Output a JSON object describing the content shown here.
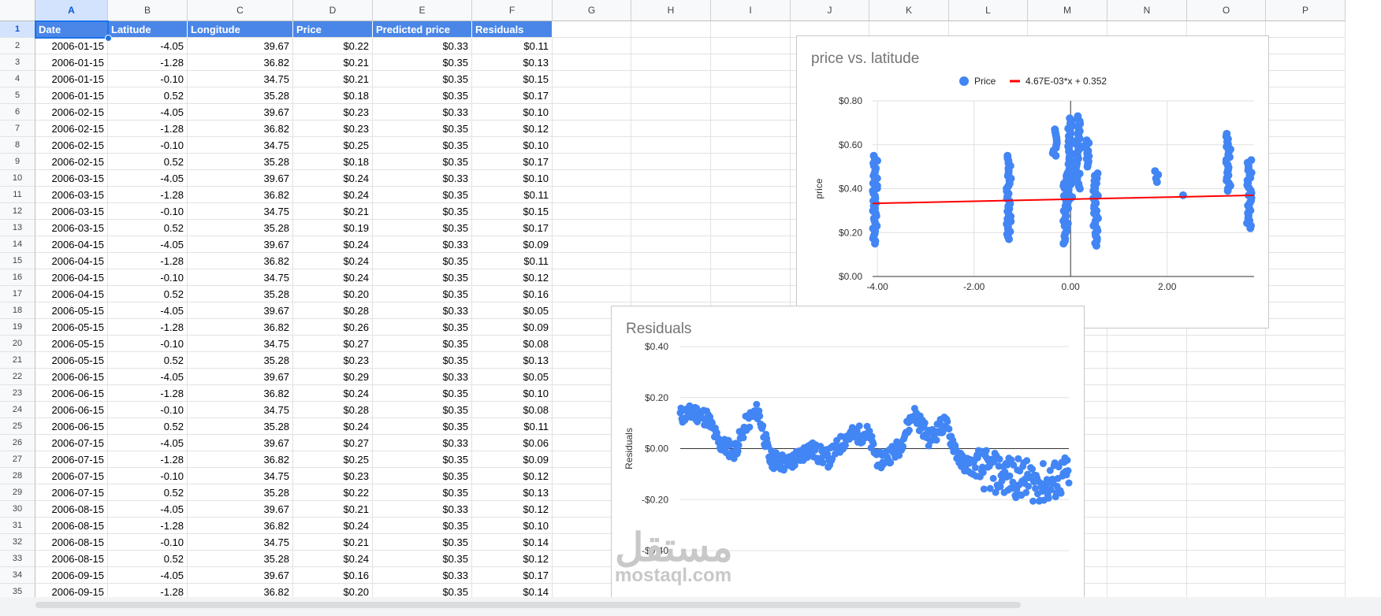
{
  "columns": [
    "A",
    "B",
    "C",
    "D",
    "E",
    "F",
    "G",
    "H",
    "I",
    "J",
    "K",
    "L",
    "M",
    "N",
    "O",
    "P"
  ],
  "selected_column": "A",
  "header_row": {
    "row_number": "1",
    "cells": [
      "Date",
      "Latitude",
      "Longitude",
      "Price",
      "Predicted price",
      "Residuals"
    ]
  },
  "rows": [
    {
      "n": "2",
      "cells": [
        "2006-01-15",
        "-4.05",
        "39.67",
        "$0.22",
        "$0.33",
        "$0.11"
      ]
    },
    {
      "n": "3",
      "cells": [
        "2006-01-15",
        "-1.28",
        "36.82",
        "$0.21",
        "$0.35",
        "$0.13"
      ]
    },
    {
      "n": "4",
      "cells": [
        "2006-01-15",
        "-0.10",
        "34.75",
        "$0.21",
        "$0.35",
        "$0.15"
      ]
    },
    {
      "n": "5",
      "cells": [
        "2006-01-15",
        "0.52",
        "35.28",
        "$0.18",
        "$0.35",
        "$0.17"
      ]
    },
    {
      "n": "6",
      "cells": [
        "2006-02-15",
        "-4.05",
        "39.67",
        "$0.23",
        "$0.33",
        "$0.10"
      ]
    },
    {
      "n": "7",
      "cells": [
        "2006-02-15",
        "-1.28",
        "36.82",
        "$0.23",
        "$0.35",
        "$0.12"
      ]
    },
    {
      "n": "8",
      "cells": [
        "2006-02-15",
        "-0.10",
        "34.75",
        "$0.25",
        "$0.35",
        "$0.10"
      ]
    },
    {
      "n": "9",
      "cells": [
        "2006-02-15",
        "0.52",
        "35.28",
        "$0.18",
        "$0.35",
        "$0.17"
      ]
    },
    {
      "n": "10",
      "cells": [
        "2006-03-15",
        "-4.05",
        "39.67",
        "$0.24",
        "$0.33",
        "$0.10"
      ]
    },
    {
      "n": "11",
      "cells": [
        "2006-03-15",
        "-1.28",
        "36.82",
        "$0.24",
        "$0.35",
        "$0.11"
      ]
    },
    {
      "n": "12",
      "cells": [
        "2006-03-15",
        "-0.10",
        "34.75",
        "$0.21",
        "$0.35",
        "$0.15"
      ]
    },
    {
      "n": "13",
      "cells": [
        "2006-03-15",
        "0.52",
        "35.28",
        "$0.19",
        "$0.35",
        "$0.17"
      ]
    },
    {
      "n": "14",
      "cells": [
        "2006-04-15",
        "-4.05",
        "39.67",
        "$0.24",
        "$0.33",
        "$0.09"
      ]
    },
    {
      "n": "15",
      "cells": [
        "2006-04-15",
        "-1.28",
        "36.82",
        "$0.24",
        "$0.35",
        "$0.11"
      ]
    },
    {
      "n": "16",
      "cells": [
        "2006-04-15",
        "-0.10",
        "34.75",
        "$0.24",
        "$0.35",
        "$0.12"
      ]
    },
    {
      "n": "17",
      "cells": [
        "2006-04-15",
        "0.52",
        "35.28",
        "$0.20",
        "$0.35",
        "$0.16"
      ]
    },
    {
      "n": "18",
      "cells": [
        "2006-05-15",
        "-4.05",
        "39.67",
        "$0.28",
        "$0.33",
        "$0.05"
      ]
    },
    {
      "n": "19",
      "cells": [
        "2006-05-15",
        "-1.28",
        "36.82",
        "$0.26",
        "$0.35",
        "$0.09"
      ]
    },
    {
      "n": "20",
      "cells": [
        "2006-05-15",
        "-0.10",
        "34.75",
        "$0.27",
        "$0.35",
        "$0.08"
      ]
    },
    {
      "n": "21",
      "cells": [
        "2006-05-15",
        "0.52",
        "35.28",
        "$0.23",
        "$0.35",
        "$0.13"
      ]
    },
    {
      "n": "22",
      "cells": [
        "2006-06-15",
        "-4.05",
        "39.67",
        "$0.29",
        "$0.33",
        "$0.05"
      ]
    },
    {
      "n": "23",
      "cells": [
        "2006-06-15",
        "-1.28",
        "36.82",
        "$0.24",
        "$0.35",
        "$0.10"
      ]
    },
    {
      "n": "24",
      "cells": [
        "2006-06-15",
        "-0.10",
        "34.75",
        "$0.28",
        "$0.35",
        "$0.08"
      ]
    },
    {
      "n": "25",
      "cells": [
        "2006-06-15",
        "0.52",
        "35.28",
        "$0.24",
        "$0.35",
        "$0.11"
      ]
    },
    {
      "n": "26",
      "cells": [
        "2006-07-15",
        "-4.05",
        "39.67",
        "$0.27",
        "$0.33",
        "$0.06"
      ]
    },
    {
      "n": "27",
      "cells": [
        "2006-07-15",
        "-1.28",
        "36.82",
        "$0.25",
        "$0.35",
        "$0.09"
      ]
    },
    {
      "n": "28",
      "cells": [
        "2006-07-15",
        "-0.10",
        "34.75",
        "$0.23",
        "$0.35",
        "$0.12"
      ]
    },
    {
      "n": "29",
      "cells": [
        "2006-07-15",
        "0.52",
        "35.28",
        "$0.22",
        "$0.35",
        "$0.13"
      ]
    },
    {
      "n": "30",
      "cells": [
        "2006-08-15",
        "-4.05",
        "39.67",
        "$0.21",
        "$0.33",
        "$0.12"
      ]
    },
    {
      "n": "31",
      "cells": [
        "2006-08-15",
        "-1.28",
        "36.82",
        "$0.24",
        "$0.35",
        "$0.10"
      ]
    },
    {
      "n": "32",
      "cells": [
        "2006-08-15",
        "-0.10",
        "34.75",
        "$0.21",
        "$0.35",
        "$0.14"
      ]
    },
    {
      "n": "33",
      "cells": [
        "2006-08-15",
        "0.52",
        "35.28",
        "$0.24",
        "$0.35",
        "$0.12"
      ]
    },
    {
      "n": "34",
      "cells": [
        "2006-09-15",
        "-4.05",
        "39.67",
        "$0.16",
        "$0.33",
        "$0.17"
      ]
    },
    {
      "n": "35",
      "cells": [
        "2006-09-15",
        "-1.28",
        "36.82",
        "$0.20",
        "$0.35",
        "$0.14"
      ]
    }
  ],
  "colors": {
    "header_fill": "#4a86e8",
    "series_blue": "#4285f4",
    "trendline_red": "#ff0000",
    "selection_blue": "#1a73e8"
  },
  "chart_data": [
    {
      "type": "scatter",
      "title": "price vs. latitude",
      "xlabel": "",
      "ylabel": "price",
      "legend_position": "top",
      "series": [
        {
          "name": "Price",
          "color": "#4285f4"
        },
        {
          "name": "4.67E-03*x + 0.352",
          "color": "#ff0000",
          "kind": "trendline",
          "slope": 0.00467,
          "intercept": 0.352
        }
      ],
      "xlim": [
        -4.1,
        3.8
      ],
      "ylim": [
        0,
        0.8
      ],
      "x_ticks": [
        "-4.00",
        "-2.00",
        "0.00",
        "2.00"
      ],
      "x_tick_values": [
        -4,
        -2,
        0,
        2
      ],
      "y_ticks": [
        "$0.00",
        "$0.20",
        "$0.40",
        "$0.60",
        "$0.80"
      ],
      "y_tick_values": [
        0,
        0.2,
        0.4,
        0.6,
        0.8
      ],
      "columns": [
        {
          "x": -4.05,
          "ymin": 0.15,
          "ymax": 0.55
        },
        {
          "x": -1.28,
          "ymin": 0.17,
          "ymax": 0.55
        },
        {
          "x": -0.33,
          "ymin": 0.55,
          "ymax": 0.67
        },
        {
          "x": -0.1,
          "ymin": 0.15,
          "ymax": 0.47
        },
        {
          "x": 0.0,
          "ymin": 0.35,
          "ymax": 0.72
        },
        {
          "x": 0.15,
          "ymin": 0.4,
          "ymax": 0.73
        },
        {
          "x": 0.33,
          "ymin": 0.5,
          "ymax": 0.62
        },
        {
          "x": 0.52,
          "ymin": 0.14,
          "ymax": 0.47
        },
        {
          "x": 1.78,
          "ymin": 0.43,
          "ymax": 0.48
        },
        {
          "x": 3.27,
          "ymin": 0.39,
          "ymax": 0.65
        },
        {
          "x": 3.7,
          "ymin": 0.22,
          "ymax": 0.53
        }
      ],
      "points": [
        {
          "x": 2.33,
          "y": 0.37
        }
      ]
    },
    {
      "type": "scatter",
      "title": "Residuals",
      "xlabel": "",
      "ylabel": "Residuals",
      "ylim": [
        -0.4,
        0.4
      ],
      "y_ticks": [
        "$0.40",
        "$0.20",
        "$0.00",
        "-$0.20",
        "-$0.40"
      ],
      "y_tick_values": [
        0.4,
        0.2,
        0,
        -0.2,
        -0.4
      ],
      "n_points": 500,
      "trend": [
        [
          0,
          0.13
        ],
        [
          20,
          0.14
        ],
        [
          35,
          0.12
        ],
        [
          50,
          0.02
        ],
        [
          70,
          -0.01
        ],
        [
          85,
          0.1
        ],
        [
          100,
          0.15
        ],
        [
          115,
          -0.04
        ],
        [
          140,
          -0.06
        ],
        [
          165,
          0.0
        ],
        [
          190,
          -0.04
        ],
        [
          215,
          0.05
        ],
        [
          240,
          0.06
        ],
        [
          255,
          -0.05
        ],
        [
          280,
          0.0
        ],
        [
          300,
          0.14
        ],
        [
          320,
          0.04
        ],
        [
          340,
          0.1
        ],
        [
          360,
          -0.05
        ],
        [
          385,
          -0.08
        ],
        [
          410,
          -0.1
        ],
        [
          440,
          -0.12
        ],
        [
          470,
          -0.14
        ],
        [
          499,
          -0.1
        ]
      ]
    }
  ],
  "watermark": {
    "arabic": "مستقل",
    "latin": "mostaql.com"
  }
}
